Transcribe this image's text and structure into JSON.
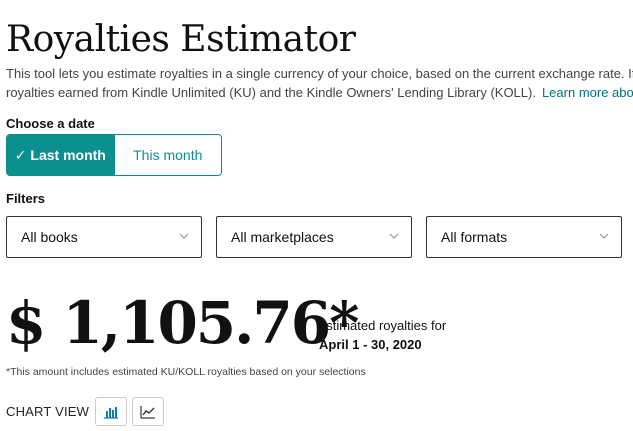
{
  "page": {
    "title": "Royalties Estimator",
    "description_line1": "This tool lets you estimate royalties in a single currency of your choice, based on the current exchange rate. If y",
    "description_line2": "royalties earned from Kindle Unlimited (KU) and the Kindle Owners' Lending Library (KOLL).",
    "learn_more": "Learn more abou"
  },
  "date_picker": {
    "label": "Choose a date",
    "options": [
      {
        "label": "Last month",
        "selected": true
      },
      {
        "label": "This month",
        "selected": false
      }
    ],
    "check_glyph": "✓"
  },
  "filters": {
    "label": "Filters",
    "books": "All books",
    "marketplaces": "All marketplaces",
    "formats": "All formats"
  },
  "estimate": {
    "amount": "$ 1,105.76*",
    "caption": "estimated royalties for",
    "period": "April 1 - 30, 2020",
    "footnote": "*This amount includes estimated KU/KOLL royalties based on your selections"
  },
  "chart_view": {
    "label": "CHART VIEW",
    "icons": [
      "bar-chart-icon",
      "line-chart-icon"
    ],
    "icon_color": "#0c7fb0"
  },
  "colors": {
    "accent": "#0c8f8f",
    "link": "#007185"
  }
}
